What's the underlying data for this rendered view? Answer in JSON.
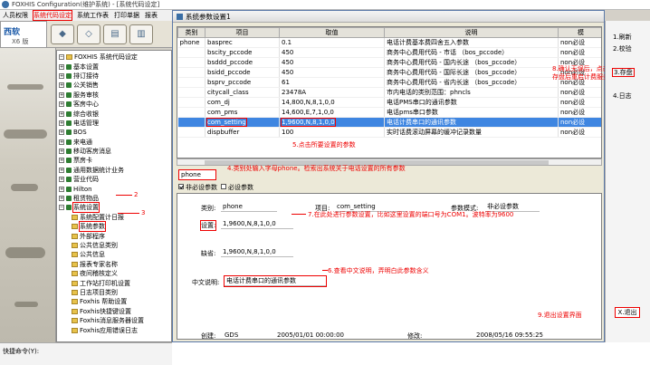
{
  "app": {
    "title": "FOXHIS Configuration(维护系统) - [系统代码设定]",
    "menu": [
      "人员权限",
      "系统代码设定",
      "系统工作表",
      "打印单据",
      "报表"
    ],
    "menu_selected_index": 1
  },
  "left": {
    "logo_main": "西软",
    "logo_sub": "X6 版",
    "bottom_label": "快捷命令(Y):"
  },
  "tree": {
    "root": "FOXHIS 系统代码设定",
    "items": [
      {
        "label": "基本设置",
        "level": 0
      },
      {
        "label": "排订接待",
        "level": 0
      },
      {
        "label": "公关销售",
        "level": 0
      },
      {
        "label": "服务审核",
        "level": 0
      },
      {
        "label": "客房中心",
        "level": 0
      },
      {
        "label": "综合收银",
        "level": 0
      },
      {
        "label": "电话管理",
        "level": 0
      },
      {
        "label": "BOS",
        "level": 0
      },
      {
        "label": "来电通",
        "level": 0
      },
      {
        "label": "移动客房消息",
        "level": 0
      },
      {
        "label": "票房卡",
        "level": 0
      },
      {
        "label": "通用数据统计业务",
        "level": 0
      },
      {
        "label": "营业代码",
        "level": 0
      },
      {
        "label": "Hilton",
        "level": 0
      },
      {
        "label": "租赁物品",
        "level": 0
      },
      {
        "label": "系统设置",
        "level": 0,
        "selected": true
      },
      {
        "label": "系统配置计日报",
        "level": 1
      },
      {
        "label": "系统参数",
        "level": 1,
        "selected": true
      },
      {
        "label": "外部程序",
        "level": 1
      },
      {
        "label": "公共信息类别",
        "level": 1
      },
      {
        "label": "公共信息",
        "level": 1
      },
      {
        "label": "报表专家名称",
        "level": 1
      },
      {
        "label": "夜间稽核定义",
        "level": 1
      },
      {
        "label": "工作站打印机设置",
        "level": 1
      },
      {
        "label": "日志项目类别",
        "level": 1
      },
      {
        "label": "Foxhis 帮助设置",
        "level": 1
      },
      {
        "label": "Foxhis快捷键设置",
        "level": 1
      },
      {
        "label": "Foxhis消息服务器设置",
        "level": 1
      },
      {
        "label": "Foxhis应用错误日志",
        "level": 1
      }
    ]
  },
  "dialog": {
    "title": "系统参数设置1",
    "columns": [
      "类别",
      "项目",
      "取值",
      "说明",
      "模"
    ],
    "rows": [
      {
        "cat": "phone",
        "item": "basprec",
        "value": "0.1",
        "desc": "电话计费基本费四舍五入参数",
        "mod": "non必设"
      },
      {
        "cat": "",
        "item": "bscity_pccode",
        "value": "450",
        "desc": "商务中心费用代码 - 市话  （bos_pccode）",
        "mod": "non必设"
      },
      {
        "cat": "",
        "item": "bsddd_pccode",
        "value": "450",
        "desc": "商务中心费用代码 - 国内长途  （bos_pccode）",
        "mod": "non必设"
      },
      {
        "cat": "",
        "item": "bsidd_pccode",
        "value": "450",
        "desc": "商务中心费用代码 - 国际长途  （bos_pccode）",
        "mod": "non必设"
      },
      {
        "cat": "",
        "item": "bsprv_pccode",
        "value": "61",
        "desc": "商务中心费用代码 - 省内长途  （bos_pccode）",
        "mod": "non必设"
      },
      {
        "cat": "",
        "item": "citycall_class",
        "value": "23478A",
        "desc": "市内电话的类别范围：phncls",
        "mod": "non必设"
      },
      {
        "cat": "",
        "item": "com_dj",
        "value": "14,800,N,8,1,0,0",
        "desc": "电话PMS串口的通讯参数",
        "mod": "non必设"
      },
      {
        "cat": "",
        "item": "com_pms",
        "value": "14,600,E,7,1,0,0",
        "desc": "电话pms串口参数",
        "mod": "non必设"
      },
      {
        "cat": "",
        "item": "com_setting",
        "value": "1,9600,N,8,1,0,0",
        "desc": "电话计费串口的通讯参数",
        "mod": "non必设",
        "selected": true
      },
      {
        "cat": "",
        "item": "dispbuffer",
        "value": "100",
        "desc": "实时话费滚动屏幕的缓冲记录数量",
        "mod": "non必设"
      }
    ],
    "filter_value": "phone",
    "checkboxes": [
      {
        "label": "非必设参数",
        "checked": true
      },
      {
        "label": "必设参数",
        "checked": false
      }
    ],
    "detail": {
      "category_label": "类别:",
      "category_value": "phone",
      "item_label": "项目:",
      "item_value": "com_setting",
      "mode_label": "参数模式:",
      "mode_value": "非必设参数",
      "setting_label": "设置:",
      "setting_value": "1,9600,N,8,1,0,0",
      "default_label": "缺省:",
      "default_value": "1,9600,N,8,1,0,0",
      "cn_label": "中文说明:",
      "cn_value": "电话计费串口的通讯参数",
      "created_label": "创建:",
      "created_by": "GDS",
      "created_time": "2005/01/01 00:00:00",
      "modified_label": "修改:",
      "modified_time": "2008/05/16 09:55:25"
    }
  },
  "right_buttons": {
    "refresh": "1.刷新",
    "check": "2.校验",
    "save": "3.存盘",
    "log": "4.日志",
    "exit": "X.退出"
  },
  "annotations": {
    "a2": "2",
    "a3": "3",
    "a4": "4.类别处输入字母phone。检索出系统关于电话设置的所有参数",
    "a5": "5.点击所要设置的参数",
    "a6": "6.查看中文说明，弄明白此参数含义",
    "a7": "7.在此处进行参数设置，比如这里设置的端口号为COM1。波特率为9600",
    "a8": "8.确认无误后，点击存盘",
    "a8b": "存盘后重启计费服务程序",
    "a9": "9.退出设置界面"
  },
  "colors": {
    "accent": "#3f86e1",
    "annotation": "#ee0000",
    "dialog_border": "#5b79a8"
  }
}
